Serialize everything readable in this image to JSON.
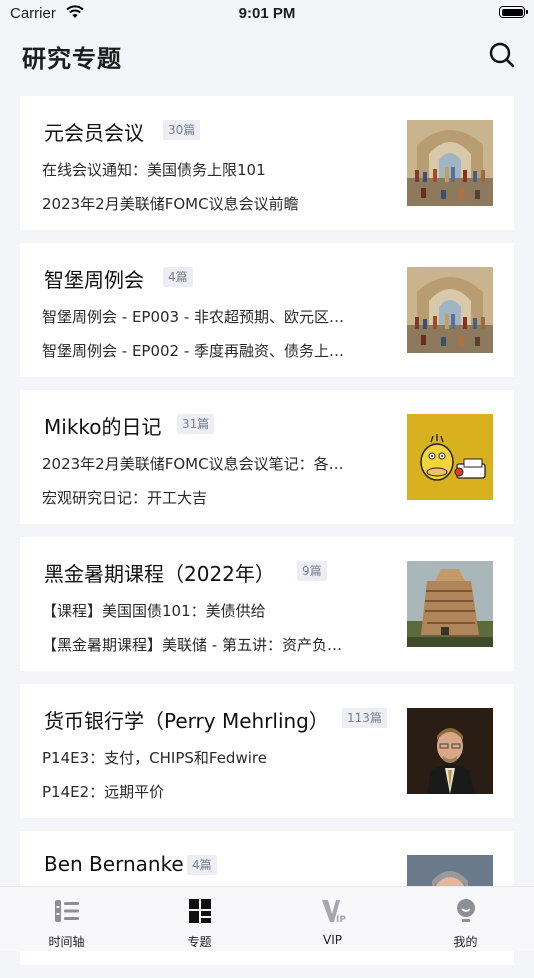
{
  "status_bar": {
    "carrier": "Carrier",
    "time": "9:01 PM"
  },
  "header": {
    "title": "研究专题"
  },
  "topics": [
    {
      "title": "元会员会议",
      "count": "30篇",
      "lines": [
        "在线会议通知：美国债务上限101",
        "2023年2月美联储FOMC议息会议前瞻"
      ]
    },
    {
      "title": "智堡周例会",
      "count": "4篇",
      "lines": [
        "智堡周例会 - EP003 - 非农超预期、欧元区…",
        "智堡周例会 - EP002 - 季度再融资、债务上…"
      ]
    },
    {
      "title": "Mikko的日记",
      "count": "31篇",
      "lines": [
        "2023年2月美联储FOMC议息会议笔记：各…",
        "宏观研究日记：开工大吉"
      ]
    },
    {
      "title": "黑金暑期课程（2022年）",
      "count": "9篇",
      "lines": [
        "【课程】美国国债101：美债供给",
        "【黑金暑期课程】美联储 - 第五讲：资产负…"
      ]
    },
    {
      "title": "货币银行学（Perry Mehrling）",
      "count": "113篇",
      "lines": [
        "P14E3：支付，CHIPS和Fedwire",
        "P14E2：远期平价"
      ]
    },
    {
      "title": "Ben Bernanke",
      "count": "4篇",
      "lines": [
        "",
        ""
      ]
    }
  ],
  "tab_bar": {
    "tabs": [
      {
        "label": "时间轴",
        "icon": "timeline-icon"
      },
      {
        "label": "专题",
        "icon": "topics-grid-icon"
      },
      {
        "label": "VIP",
        "icon": "vip-icon"
      },
      {
        "label": "我的",
        "icon": "profile-icon"
      }
    ]
  },
  "colors": {
    "badge_bg": "#eceef4",
    "badge_text": "#7a8190",
    "page_bg": "#f4f5f8",
    "card_bg": "#ffffff"
  }
}
